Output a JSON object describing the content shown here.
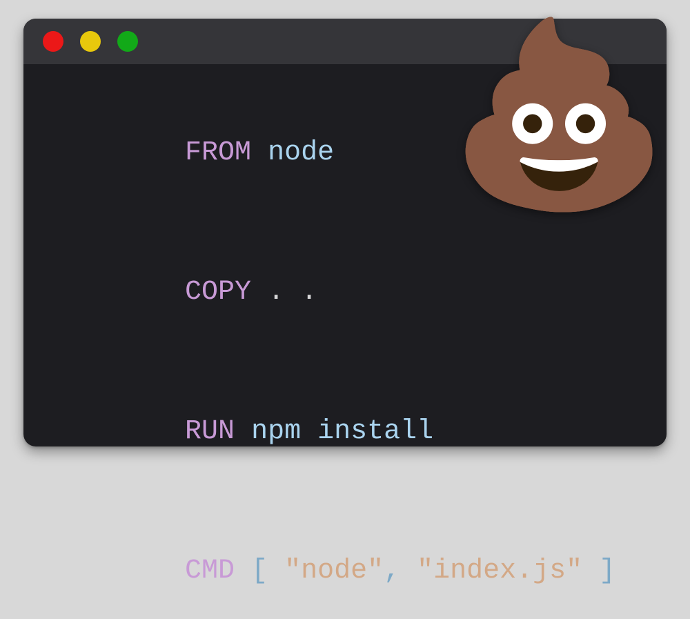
{
  "window": {
    "traffic": {
      "close": "red",
      "min": "yellow",
      "max": "green"
    }
  },
  "code": {
    "l1": {
      "kw": "FROM",
      "arg": "node"
    },
    "l2": {
      "kw": "COPY",
      "arg": ". ."
    },
    "l3": {
      "kw": "RUN",
      "arg": "npm install"
    },
    "l4": {
      "kw": "CMD",
      "open": "[ ",
      "s1": "\"node\"",
      "comma": ", ",
      "s2": "\"index.js\"",
      "close": " ]"
    }
  },
  "sticker": {
    "emoji": "💩"
  }
}
